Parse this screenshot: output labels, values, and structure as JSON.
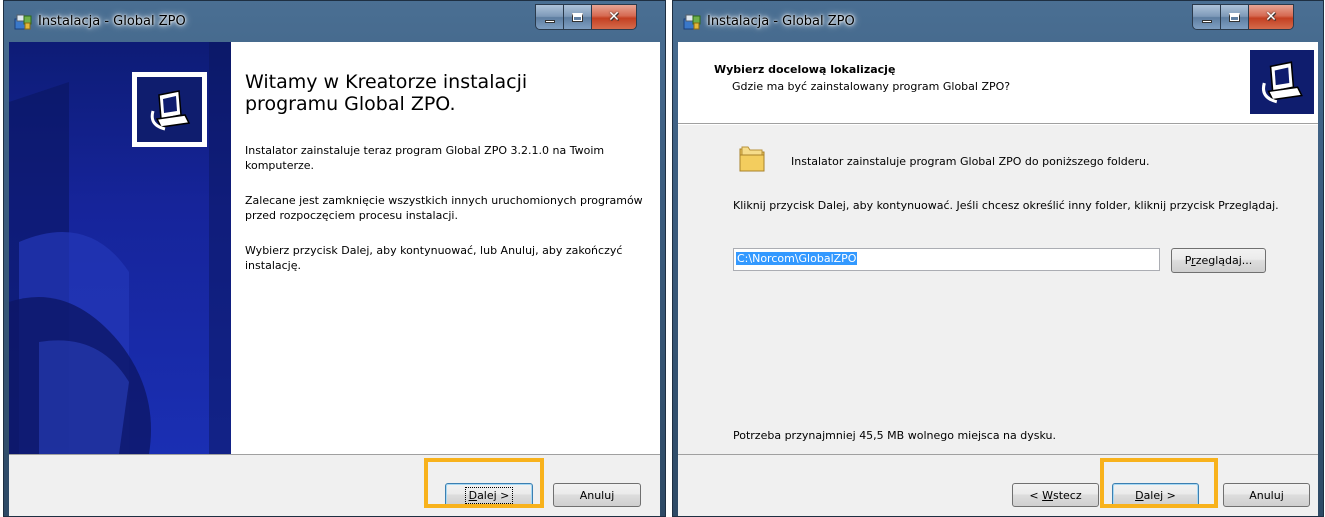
{
  "window1": {
    "title": "Instalacja - Global ZPO",
    "heading": "Witamy w Kreatorze instalacji programu Global ZPO.",
    "paragraph1": "Instalator zainstaluje teraz program Global ZPO 3.2.1.0 na Twoim komputerze.",
    "paragraph2": "Zalecane jest zamknięcie wszystkich innych uruchomionych programów przed rozpoczęciem procesu instalacji.",
    "paragraph3": "Wybierz przycisk Dalej, aby kontynuować, lub Anuluj, aby zakończyć instalację.",
    "buttons": {
      "next_mnemonic": "D",
      "next_rest": "alej >",
      "cancel": "Anuluj"
    }
  },
  "window2": {
    "title": "Instalacja - Global ZPO",
    "header_title": "Wybierz docelową lokalizację",
    "header_subtitle": "Gdzie ma być zainstalowany program Global ZPO?",
    "folder_text": "Instalator zainstaluje program Global ZPO do poniższego folderu.",
    "instruction": "Kliknij przycisk Dalej, aby kontynuować. Jeśli chcesz określić inny folder, kliknij przycisk Przeglądaj.",
    "path_value": "C:\\Norcom\\GlobalZPO",
    "browse_pre": "P",
    "browse_mnemonic": "r",
    "browse_rest": "zeglądaj...",
    "space_required": "Potrzeba przynajmniej 45,5 MB wolnego miejsca na dysku.",
    "buttons": {
      "back_pre": "< ",
      "back_mnemonic": "W",
      "back_rest": "stecz",
      "next_mnemonic": "D",
      "next_rest": "alej >",
      "cancel": "Anuluj"
    }
  },
  "colors": {
    "highlight": "#f8b21c",
    "banner": "#16249a",
    "selection": "#3399ff"
  },
  "icons": {
    "title_icon": "installer-icon",
    "banner_logo": "computer-install-icon",
    "folder": "folder-icon"
  }
}
